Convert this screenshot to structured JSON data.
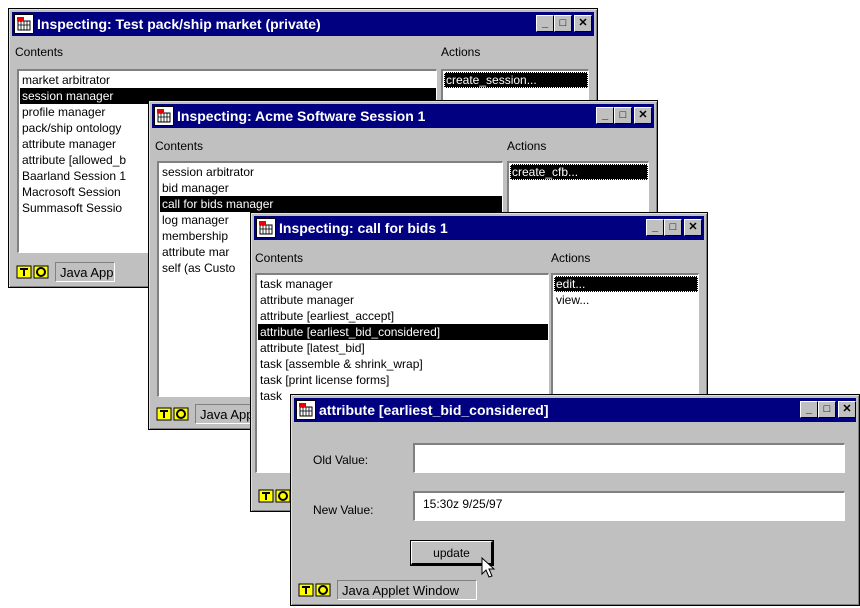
{
  "windows": {
    "market": {
      "title": "Inspecting: Test pack/ship market (private)",
      "contents_label": "Contents",
      "actions_label": "Actions",
      "contents": [
        "market arbitrator",
        "session manager",
        "profile manager",
        "pack/ship ontology",
        "attribute manager",
        "attribute [allowed_b",
        "Baarland Session 1",
        "Macrosoft Session",
        "Summasoft Sessio"
      ],
      "selected_index": 1,
      "actions": [
        "create_session..."
      ],
      "status": "Java Applet Window"
    },
    "session": {
      "title": "Inspecting: Acme Software Session 1",
      "contents_label": "Contents",
      "actions_label": "Actions",
      "contents": [
        "session arbitrator",
        "bid manager",
        "call for bids manager",
        "log manager",
        "membership",
        "attribute mar",
        "self (as Custo"
      ],
      "selected_index": 2,
      "actions": [
        "create_cfb..."
      ],
      "status": "Java Apple"
    },
    "cfb": {
      "title": "Inspecting: call for bids 1",
      "contents_label": "Contents",
      "actions_label": "Actions",
      "contents": [
        "task manager",
        "attribute manager",
        "attribute [earliest_accept]",
        "attribute [earliest_bid_considered]",
        "attribute [latest_bid]",
        "task [assemble & shrink_wrap]",
        "task [print license forms]",
        "task"
      ],
      "selected_index": 3,
      "actions": [
        "edit...",
        "view..."
      ],
      "status": ""
    },
    "attribute": {
      "title": "attribute [earliest_bid_considered]",
      "old_value_label": "Old Value:",
      "old_value": "",
      "new_value_label": "New Value:",
      "new_value": "15:30z 9/25/97",
      "update_label": "update",
      "status": "Java Applet Window"
    }
  },
  "titlebar_buttons": {
    "minimize": "_",
    "maximize": "□",
    "close": "✕"
  },
  "icons": {
    "app": "applet-icon",
    "status": "java-coffee-icon",
    "cursor": "arrow-cursor-icon"
  },
  "colors": {
    "titlebar": "#000080",
    "face": "#c0c0c0",
    "selection": "#000000"
  }
}
